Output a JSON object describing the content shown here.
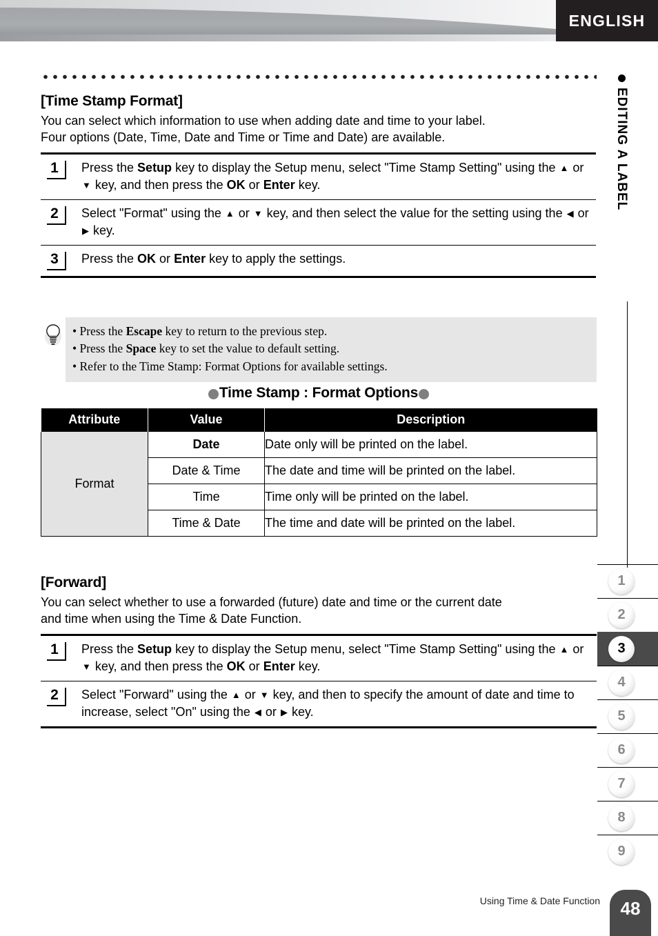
{
  "header": {
    "language_tab": "ENGLISH"
  },
  "side_label": {
    "text": "EDITING A LABEL"
  },
  "section1": {
    "heading": "[Time Stamp Format]",
    "intro_line1": "You can select which information to use when adding date and time to your label.",
    "intro_line2": "Four options (Date, Time, Date and Time or Time and Date) are available.",
    "steps": [
      {
        "num": "1",
        "parts": [
          {
            "t": "Press the ",
            "b": false
          },
          {
            "t": "Setup",
            "b": true
          },
          {
            "t": " key to display the Setup menu, select \"Time Stamp Setting\" using the ",
            "b": false
          },
          {
            "t": "▲",
            "b": false,
            "arrow": true
          },
          {
            "t": " or ",
            "b": false
          },
          {
            "t": "▼",
            "b": false,
            "arrow": true
          },
          {
            "t": " key, and then press the ",
            "b": false
          },
          {
            "t": "OK",
            "b": true
          },
          {
            "t": " or ",
            "b": false
          },
          {
            "t": "Enter",
            "b": true
          },
          {
            "t": " key.",
            "b": false
          }
        ]
      },
      {
        "num": "2",
        "parts": [
          {
            "t": "Select \"Format\" using the ",
            "b": false
          },
          {
            "t": "▲",
            "b": false,
            "arrow": true
          },
          {
            "t": " or ",
            "b": false
          },
          {
            "t": "▼",
            "b": false,
            "arrow": true
          },
          {
            "t": " key, and then select the value for the setting using the ",
            "b": false
          },
          {
            "t": "◀",
            "b": false,
            "arrow": true
          },
          {
            "t": " or ",
            "b": false
          },
          {
            "t": "▶",
            "b": false,
            "arrow": true
          },
          {
            "t": " key.",
            "b": false
          }
        ]
      },
      {
        "num": "3",
        "parts": [
          {
            "t": "Press the ",
            "b": false
          },
          {
            "t": "OK",
            "b": true
          },
          {
            "t": " or ",
            "b": false
          },
          {
            "t": "Enter",
            "b": true
          },
          {
            "t": " key to apply the settings.",
            "b": false
          }
        ]
      }
    ]
  },
  "note": {
    "icon": "lightbulb-icon",
    "lines": [
      [
        {
          "t": "• Press the ",
          "b": false
        },
        {
          "t": "Escape",
          "b": true
        },
        {
          "t": " key to return to the previous step.",
          "b": false
        }
      ],
      [
        {
          "t": "• Press the ",
          "b": false
        },
        {
          "t": "Space",
          "b": true
        },
        {
          "t": " key to set the value to default setting.",
          "b": false
        }
      ],
      [
        {
          "t": "• Refer to the Time Stamp: Format Options for available settings.",
          "b": false
        }
      ]
    ]
  },
  "table": {
    "title": "Time Stamp : Format Options",
    "bullet_color": "#7f7f7f",
    "headers": [
      "Attribute",
      "Value",
      "Description"
    ],
    "attribute": "Format",
    "rows": [
      {
        "value": "Date",
        "bold": true,
        "description": "Date only will be printed on the label."
      },
      {
        "value": "Date & Time",
        "bold": false,
        "description": "The date and time will be printed on the label."
      },
      {
        "value": "Time",
        "bold": false,
        "description": "Time only will be printed on the label."
      },
      {
        "value": "Time & Date",
        "bold": false,
        "description": "The time and date will be printed on the label."
      }
    ]
  },
  "section2": {
    "heading": "[Forward]",
    "intro_line1": "You can select whether to use a forwarded (future) date and time or the current date",
    "intro_line2": "and time when using the Time & Date Function.",
    "steps": [
      {
        "num": "1",
        "parts": [
          {
            "t": "Press the ",
            "b": false
          },
          {
            "t": "Setup",
            "b": true
          },
          {
            "t": " key to display the Setup menu, select \"Time Stamp Setting\" using the ",
            "b": false
          },
          {
            "t": "▲",
            "b": false,
            "arrow": true
          },
          {
            "t": " or ",
            "b": false
          },
          {
            "t": "▼",
            "b": false,
            "arrow": true
          },
          {
            "t": " key, and then press the ",
            "b": false
          },
          {
            "t": "OK",
            "b": true
          },
          {
            "t": " or ",
            "b": false
          },
          {
            "t": "Enter",
            "b": true
          },
          {
            "t": " key.",
            "b": false
          }
        ]
      },
      {
        "num": "2",
        "parts": [
          {
            "t": "Select \"Forward\" using the ",
            "b": false
          },
          {
            "t": "▲",
            "b": false,
            "arrow": true
          },
          {
            "t": " or ",
            "b": false
          },
          {
            "t": "▼",
            "b": false,
            "arrow": true
          },
          {
            "t": " key, and then to specify the amount of date and time to increase, select \"On\" using the ",
            "b": false
          },
          {
            "t": "◀",
            "b": false,
            "arrow": true
          },
          {
            "t": " or ",
            "b": false
          },
          {
            "t": "▶",
            "b": false,
            "arrow": true
          },
          {
            "t": " key.",
            "b": false
          }
        ]
      }
    ]
  },
  "chapter_tabs": {
    "items": [
      "1",
      "2",
      "3",
      "4",
      "5",
      "6",
      "7",
      "8",
      "9"
    ],
    "active": "3",
    "active_bg": "#4a4a4a"
  },
  "footer": {
    "caption": "Using Time & Date Function",
    "page_number": "48"
  }
}
